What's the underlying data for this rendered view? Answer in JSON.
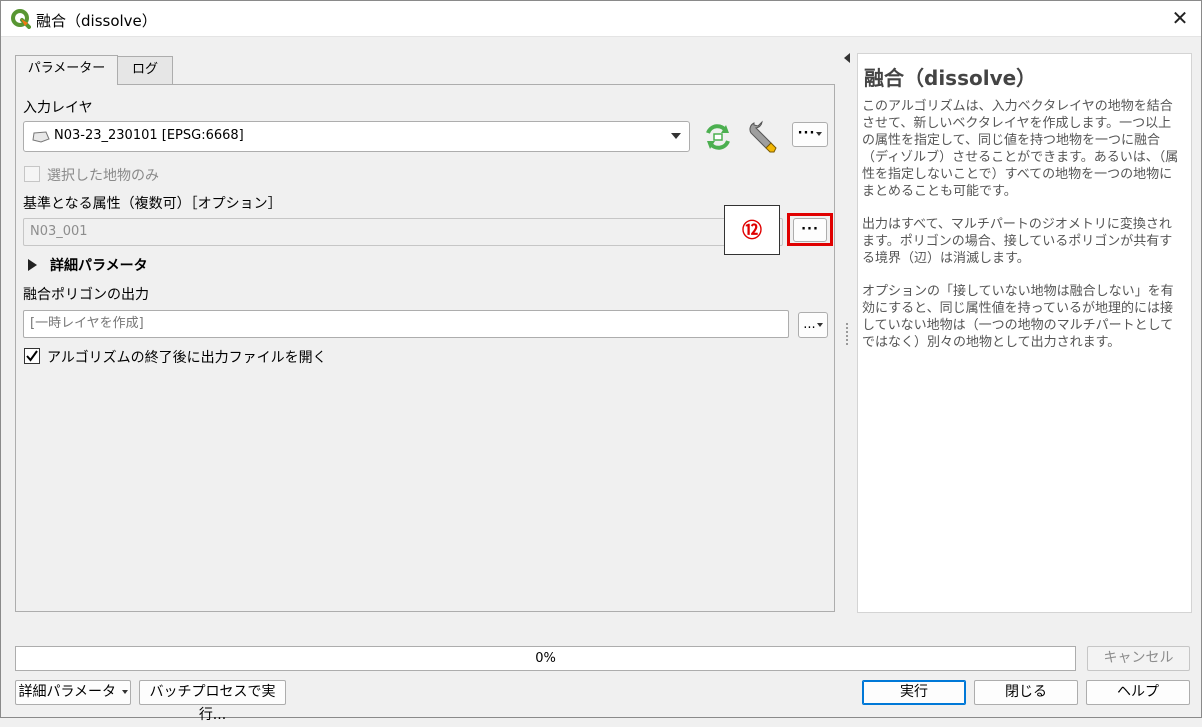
{
  "window": {
    "title": "融合（dissolve）"
  },
  "tabs": [
    {
      "label": "パラメーター"
    },
    {
      "label": "ログ"
    }
  ],
  "params": {
    "input_layer_label": "入力レイヤ",
    "input_layer_value": "N03-23_230101 [EPSG:6668]",
    "selected_only_label": "選択した地物のみ",
    "dissolve_field_label": "基準となる属性（複数可）［オプション］",
    "dissolve_field_value": "N03_001",
    "advanced_label": "詳細パラメータ",
    "output_label": "融合ポリゴンの出力",
    "output_placeholder": "[一時レイヤを作成]",
    "open_output_label": "アルゴリズムの終了後に出力ファイルを開く",
    "dots": "···",
    "small_dots": "..."
  },
  "annotation": {
    "callout_number": "⑫"
  },
  "help": {
    "title": "融合（dissolve）",
    "paragraphs": [
      "このアルゴリズムは、入力ベクタレイヤの地物を結合させて、新しいベクタレイヤを作成します。一つ以上の属性を指定して、同じ値を持つ地物を一つに融合（ディゾルブ）させることができます。あるいは、（属性を指定しないことで）すべての地物を一つの地物にまとめることも可能です。",
      "出力はすべて、マルチパートのジオメトリに変換されます。ポリゴンの場合、接しているポリゴンが共有する境界（辺）は消滅します。",
      "オプションの「接していない地物は融合しない」を有効にすると、同じ属性値を持っているが地理的には接していない地物は（一つの地物のマルチパートとしてではなく）別々の地物として出力されます。"
    ]
  },
  "progress": {
    "text": "0%",
    "value": 0
  },
  "buttons": {
    "cancel": "キャンセル",
    "advanced": "詳細パラメータ",
    "batch": "バッチプロセスで実行...",
    "run": "実行",
    "close": "閉じる",
    "help": "ヘルプ"
  },
  "colors": {
    "highlight": "#e00000",
    "qgis_green": "#589632"
  }
}
